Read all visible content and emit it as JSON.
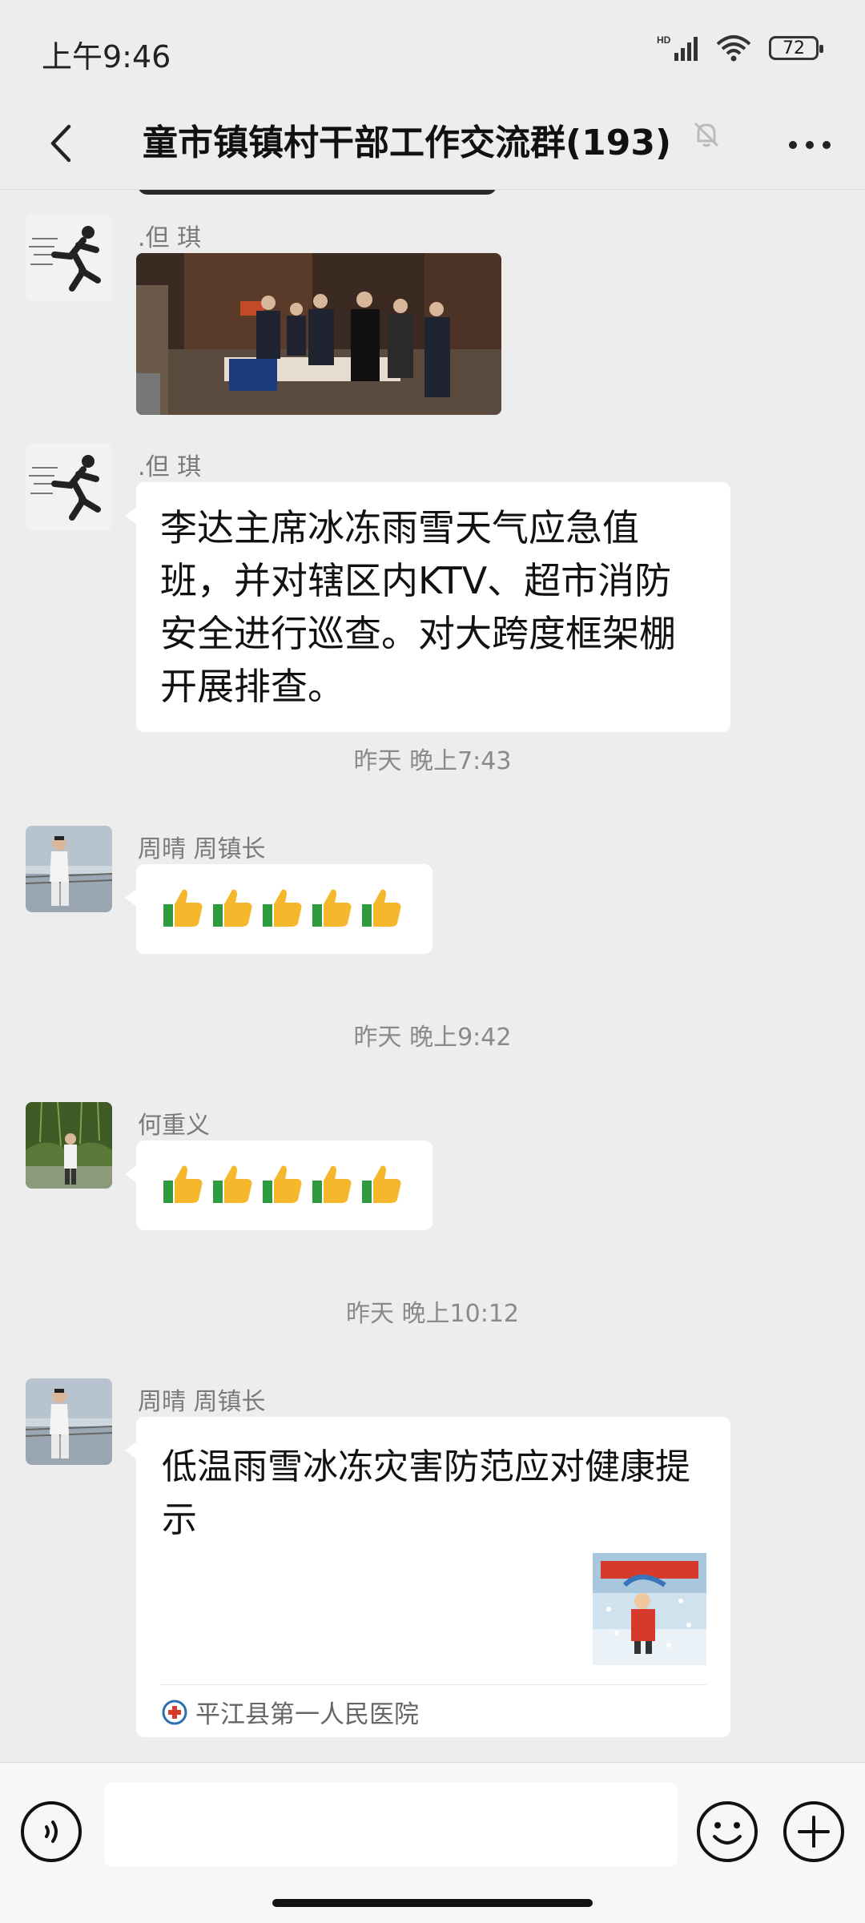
{
  "status_bar": {
    "time": "上午9:46",
    "battery": "72",
    "network": "HD"
  },
  "header": {
    "title": "童市镇镇村干部工作交流群(193)"
  },
  "messages": [
    {
      "sender": ".但   琪"
    },
    {
      "sender": ".但   琪",
      "text": "李达主席冰冻雨雪天气应急值班，并对辖区内KTV、超市消防安全进行巡查。对大跨度框架棚开展排查。"
    },
    {
      "timestamp": "昨天 晚上7:43"
    },
    {
      "sender": "周晴 周镇长",
      "emoji": "thumbs-up x5"
    },
    {
      "timestamp": "昨天 晚上9:42"
    },
    {
      "sender": "何重义",
      "emoji": "thumbs-up x5"
    },
    {
      "timestamp": "昨天 晚上10:12"
    },
    {
      "sender": "周晴 周镇长",
      "link_title": "低温雨雪冰冻灾害防范应对健康提示",
      "link_source": "平江县第一人民医院"
    }
  ],
  "colors": {
    "background": "#ededed",
    "bubble": "#ffffff",
    "thumb_yellow": "#f5b72b",
    "thumb_green": "#2e9b3e"
  }
}
